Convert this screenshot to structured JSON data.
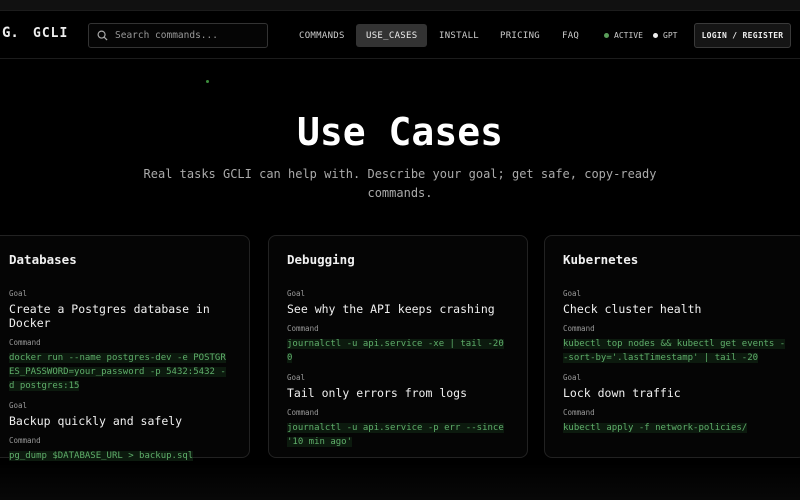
{
  "header": {
    "logo": "G.",
    "brand": "GCLI",
    "search_placeholder": "Search commands...",
    "nav": [
      {
        "label": "COMMANDS"
      },
      {
        "label": "USE_CASES"
      },
      {
        "label": "INSTALL"
      },
      {
        "label": "PRICING"
      },
      {
        "label": "FAQ"
      }
    ],
    "status": [
      {
        "label": "ACTIVE",
        "color": "#5a9e5a"
      },
      {
        "label": "GPT",
        "color": "#eeeeee"
      }
    ],
    "login": "LOGIN / REGISTER"
  },
  "hero": {
    "title": "Use Cases",
    "subtitle": "Real tasks GCLI can help with. Describe your goal; get safe, copy-ready commands."
  },
  "labels": {
    "goal": "Goal",
    "command": "Command"
  },
  "cards": [
    {
      "title": "Databases",
      "items": [
        {
          "goal": "Create a Postgres database in Docker",
          "command": "docker run --name postgres-dev -e POSTGRES_PASSWORD=your_password -p 5432:5432 -d postgres:15"
        },
        {
          "goal": "Backup quickly and safely",
          "command": "pg_dump $DATABASE_URL > backup.sql"
        }
      ]
    },
    {
      "title": "Debugging",
      "items": [
        {
          "goal": "See why the API keeps crashing",
          "command": "journalctl -u api.service -xe | tail -200"
        },
        {
          "goal": "Tail only errors from logs",
          "command": "journalctl -u api.service -p err --since '10 min ago'"
        }
      ]
    },
    {
      "title": "Kubernetes",
      "items": [
        {
          "goal": "Check cluster health",
          "command": "kubectl top nodes && kubectl get events --sort-by='.lastTimestamp' | tail -20"
        },
        {
          "goal": "Lock down traffic",
          "command": "kubectl apply -f network-policies/"
        }
      ]
    }
  ]
}
